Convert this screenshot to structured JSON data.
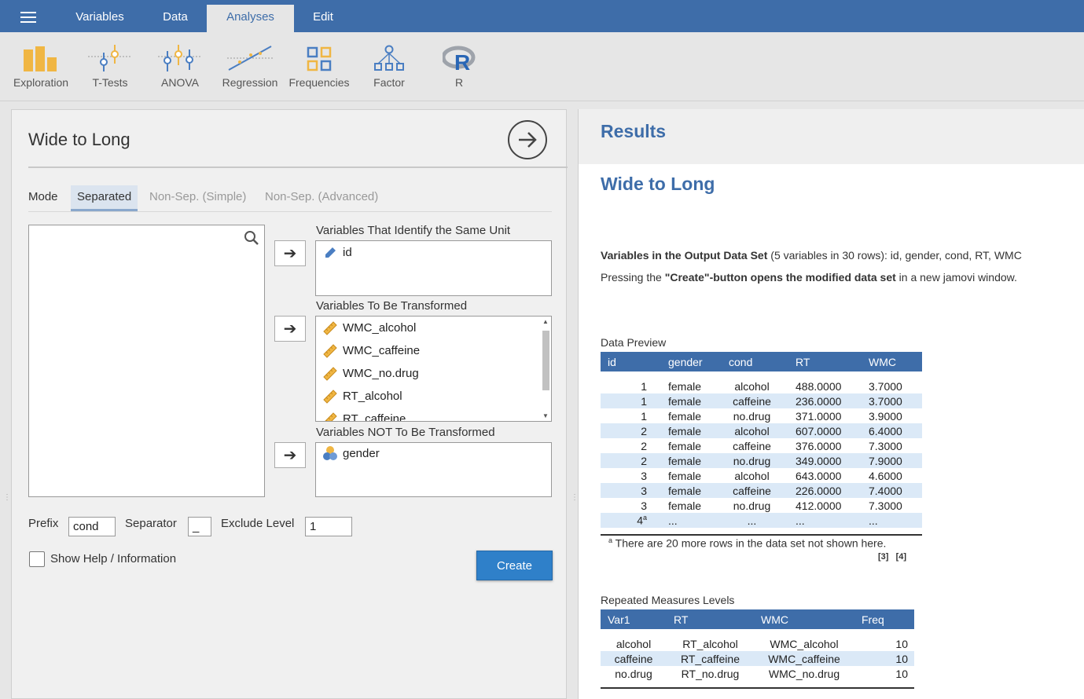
{
  "topbar": {
    "menu_icon": "hamburger-icon",
    "tabs": [
      {
        "label": "Variables",
        "active": false
      },
      {
        "label": "Data",
        "active": false
      },
      {
        "label": "Analyses",
        "active": true
      },
      {
        "label": "Edit",
        "active": false
      }
    ]
  },
  "ribbon": {
    "buttons": [
      {
        "label": "Exploration",
        "icon": "bar-chart-icon"
      },
      {
        "label": "T-Tests",
        "icon": "ttest-icon"
      },
      {
        "label": "ANOVA",
        "icon": "anova-icon"
      },
      {
        "label": "Regression",
        "icon": "regression-icon"
      },
      {
        "label": "Frequencies",
        "icon": "frequencies-icon"
      },
      {
        "label": "Factor",
        "icon": "factor-icon"
      },
      {
        "label": "R",
        "icon": "r-logo-icon"
      }
    ]
  },
  "analysis": {
    "title": "Wide to Long",
    "mode_label": "Mode",
    "mode_tabs": [
      {
        "label": "Separated",
        "active": true
      },
      {
        "label": "Non-Sep. (Simple)",
        "active": false
      },
      {
        "label": "Non-Sep. (Advanced)",
        "active": false
      }
    ],
    "id_box": {
      "label": "Variables That Identify the Same Unit",
      "items": [
        {
          "name": "id",
          "icon": "id-pencil-icon"
        }
      ]
    },
    "transform_box": {
      "label": "Variables To Be Transformed",
      "items": [
        {
          "name": "WMC_alcohol",
          "icon": "ruler-icon"
        },
        {
          "name": "WMC_caffeine",
          "icon": "ruler-icon"
        },
        {
          "name": "WMC_no.drug",
          "icon": "ruler-icon"
        },
        {
          "name": "RT_alcohol",
          "icon": "ruler-icon"
        },
        {
          "name": "RT_caffeine",
          "icon": "ruler-icon"
        }
      ]
    },
    "keep_box": {
      "label": "Variables NOT To Be Transformed",
      "items": [
        {
          "name": "gender",
          "icon": "nominal-icon"
        }
      ]
    },
    "prefix_label": "Prefix",
    "prefix_value": "cond",
    "separator_label": "Separator",
    "separator_value": "_",
    "exclude_label": "Exclude Level",
    "exclude_value": "1",
    "help_label": "Show Help / Information",
    "create_label": "Create"
  },
  "results": {
    "heading": "Results",
    "title": "Wide to Long",
    "vars_bold": "Variables in the Output Data Set",
    "vars_rest": " (5 variables in 30 rows): id, gender, cond, RT, WMC",
    "press_pre": "Pressing the ",
    "press_bold": "\"Create\"-button opens the modified data set",
    "press_post": " in a new jamovi window.",
    "preview": {
      "caption": "Data Preview",
      "headers": [
        "id",
        "gender",
        "cond",
        "RT",
        "WMC"
      ],
      "rows": [
        [
          "1",
          "female",
          "alcohol",
          "488.0000",
          "3.7000"
        ],
        [
          "1",
          "female",
          "caffeine",
          "236.0000",
          "3.7000"
        ],
        [
          "1",
          "female",
          "no.drug",
          "371.0000",
          "3.9000"
        ],
        [
          "2",
          "female",
          "alcohol",
          "607.0000",
          "6.4000"
        ],
        [
          "2",
          "female",
          "caffeine",
          "376.0000",
          "7.3000"
        ],
        [
          "2",
          "female",
          "no.drug",
          "349.0000",
          "7.9000"
        ],
        [
          "3",
          "female",
          "alcohol",
          "643.0000",
          "4.6000"
        ],
        [
          "3",
          "female",
          "caffeine",
          "226.0000",
          "7.4000"
        ],
        [
          "3",
          "female",
          "no.drug",
          "412.0000",
          "7.3000"
        ],
        [
          "4",
          "...",
          "...",
          "...",
          "..."
        ]
      ],
      "last_row_sup": "a",
      "note_sup": "a",
      "note": "There are 20 more rows in the data set not shown here.",
      "refs": [
        "[3]",
        "[4]"
      ]
    },
    "levels": {
      "caption": "Repeated Measures Levels",
      "headers": [
        "Var1",
        "RT",
        "WMC",
        "Freq"
      ],
      "rows": [
        [
          "alcohol",
          "RT_alcohol",
          "WMC_alcohol",
          "10"
        ],
        [
          "caffeine",
          "RT_caffeine",
          "WMC_caffeine",
          "10"
        ],
        [
          "no.drug",
          "RT_no.drug",
          "WMC_no.drug",
          "10"
        ]
      ]
    }
  },
  "colors": {
    "brand": "#3e6da9",
    "create": "#2f80c9",
    "row_alt": "#dbe9f7"
  }
}
